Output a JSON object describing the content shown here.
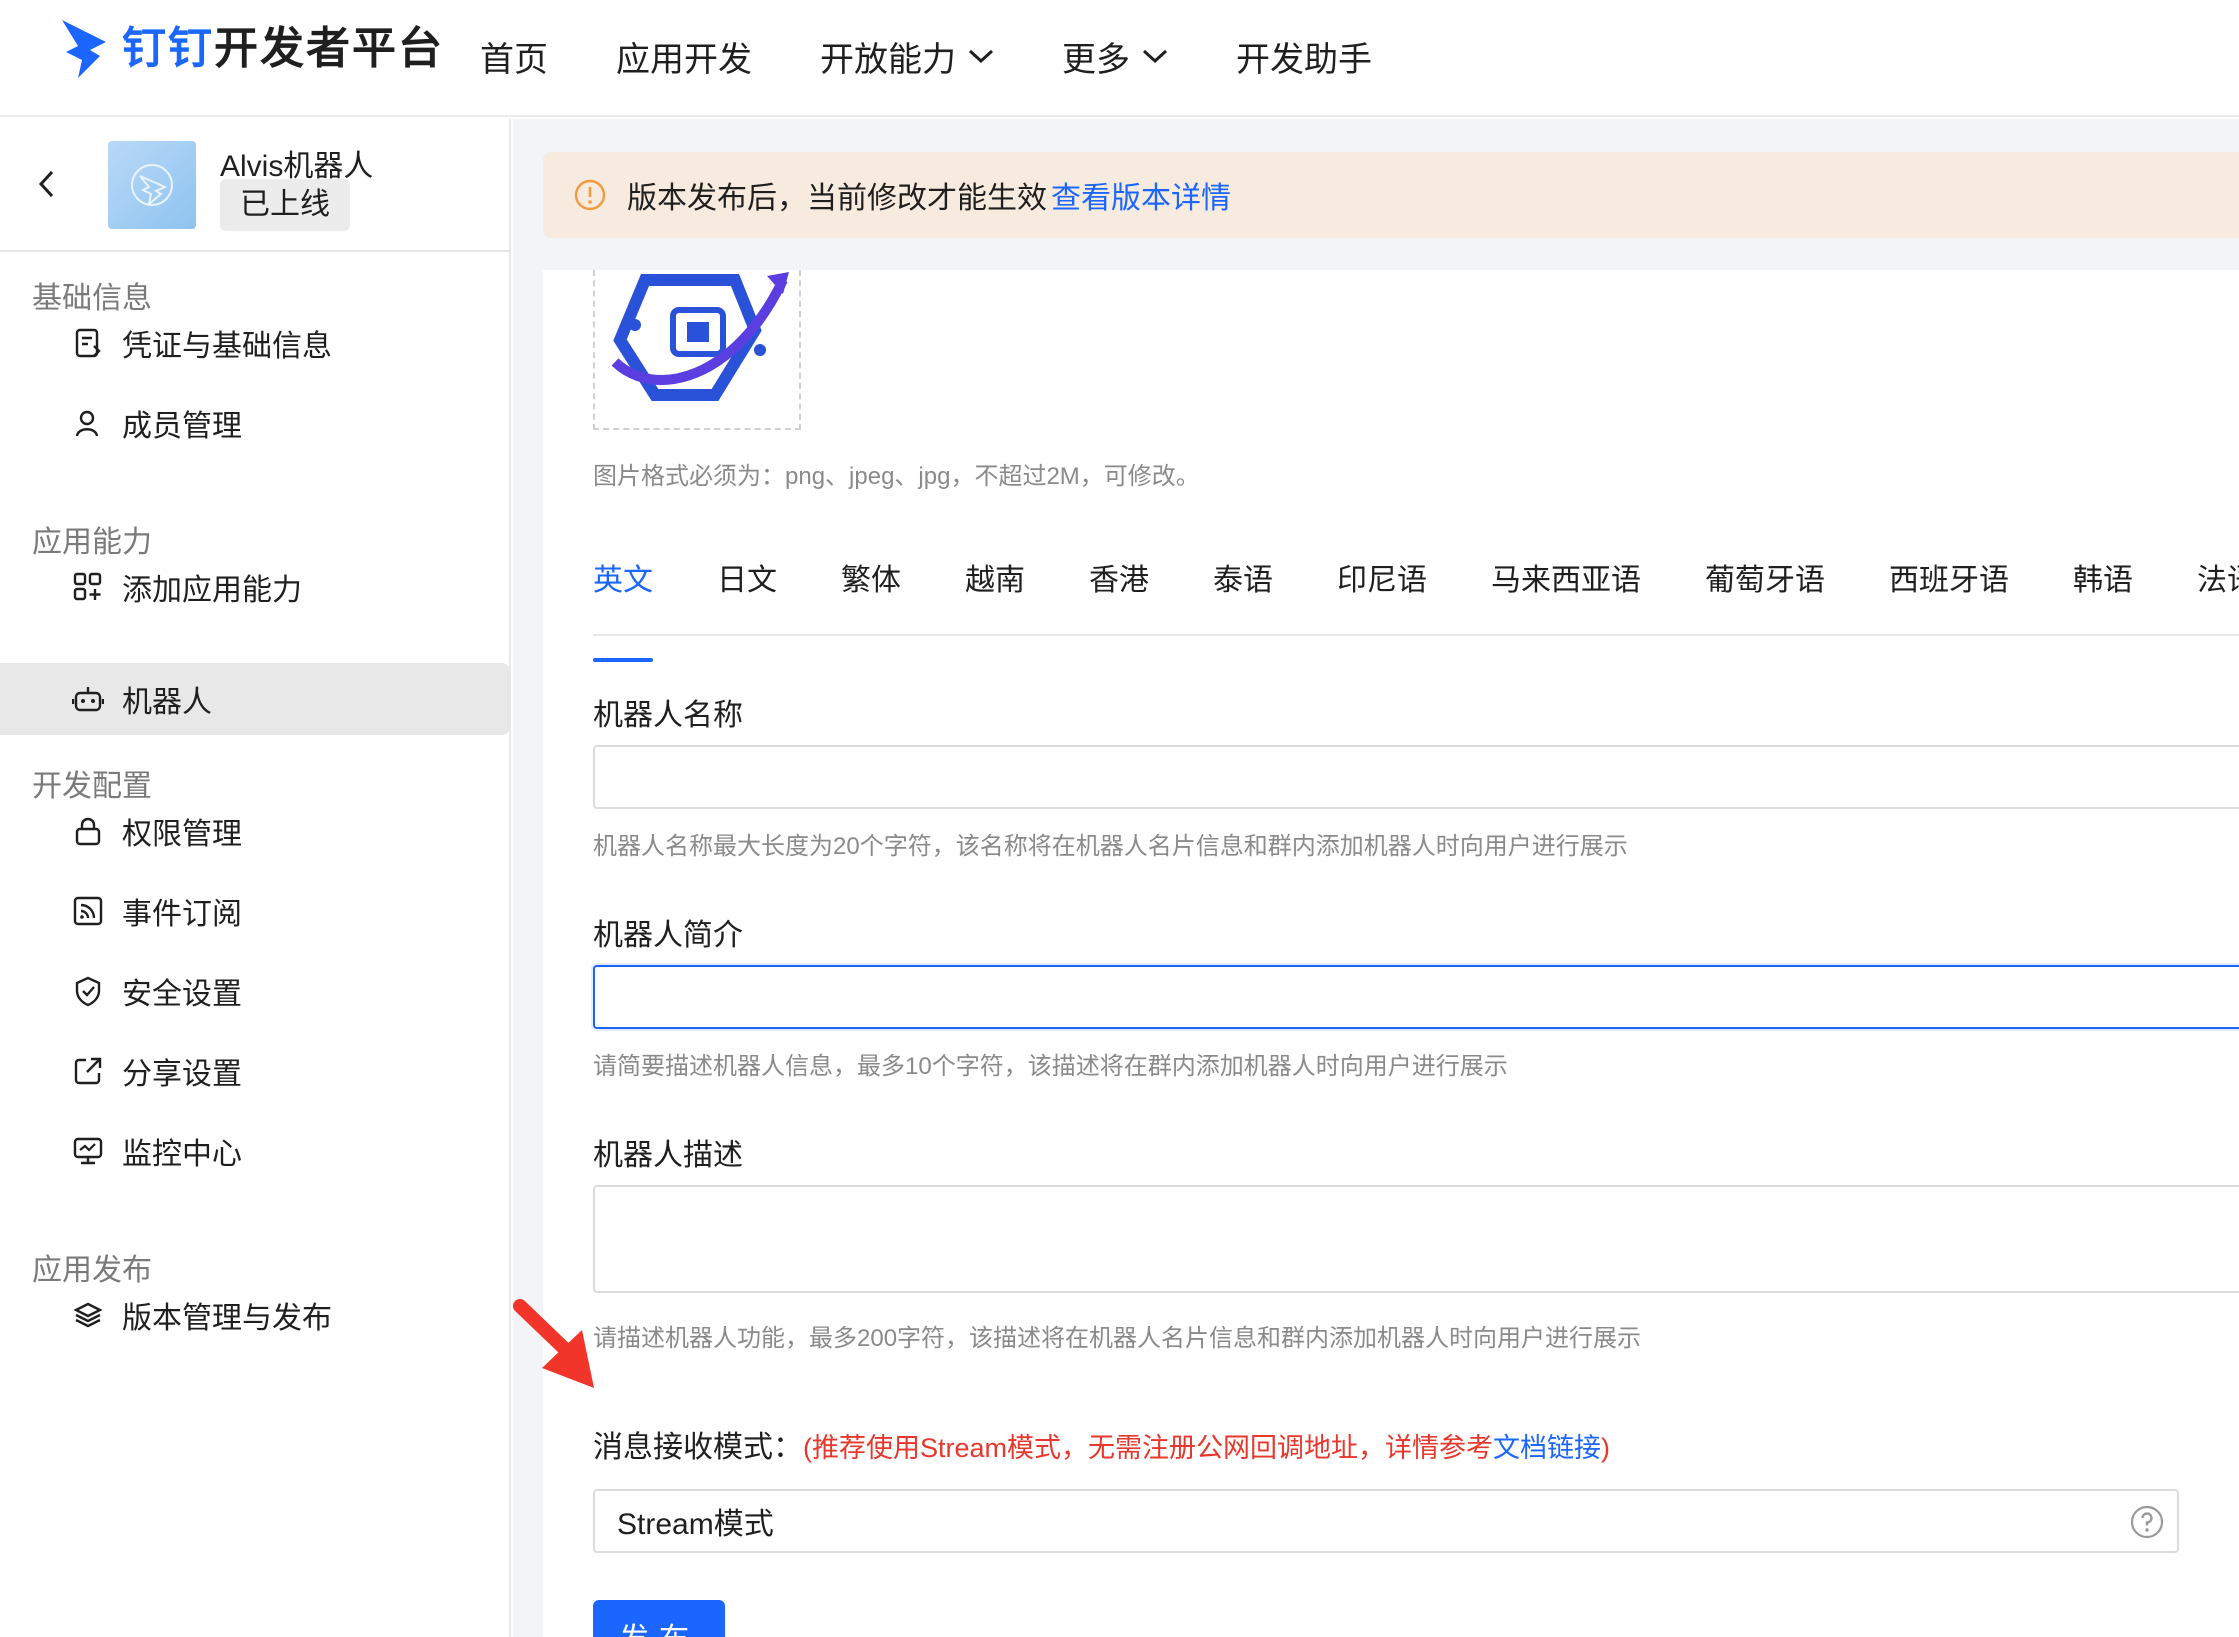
{
  "header": {
    "logo_brand": "钉钉",
    "logo_rest": "开发者平台",
    "nav": [
      {
        "label": "首页"
      },
      {
        "label": "应用开发"
      },
      {
        "label": "开放能力"
      },
      {
        "label": "更多"
      },
      {
        "label": "开发助手"
      }
    ]
  },
  "sidebar": {
    "app_name": "Alvis机器人",
    "app_status": "已上线",
    "groups": [
      {
        "title": "基础信息",
        "items": [
          {
            "label": "凭证与基础信息"
          },
          {
            "label": "成员管理"
          }
        ]
      },
      {
        "title": "应用能力",
        "items": [
          {
            "label": "添加应用能力"
          },
          {
            "label": "机器人"
          }
        ]
      },
      {
        "title": "开发配置",
        "items": [
          {
            "label": "权限管理"
          },
          {
            "label": "事件订阅"
          },
          {
            "label": "安全设置"
          },
          {
            "label": "分享设置"
          },
          {
            "label": "监控中心"
          }
        ]
      },
      {
        "title": "应用发布",
        "items": [
          {
            "label": "版本管理与发布"
          }
        ]
      }
    ]
  },
  "main": {
    "notice_text": "版本发布后，当前修改才能生效",
    "notice_link": "查看版本详情",
    "icon_hint": "图片格式必须为：png、jpeg、jpg，不超过2M，可修改。",
    "tabs": [
      "英文",
      "日文",
      "繁体",
      "越南",
      "香港",
      "泰语",
      "印尼语",
      "马来西亚语",
      "葡萄牙语",
      "西班牙语",
      "韩语",
      "法语"
    ],
    "fields": {
      "name": {
        "label": "机器人名称",
        "value": "",
        "hint": "机器人名称最大长度为20个字符，该名称将在机器人名片信息和群内添加机器人时向用户进行展示"
      },
      "intro": {
        "label": "机器人简介",
        "value": "",
        "hint": "请简要描述机器人信息，最多10个字符，该描述将在群内添加机器人时向用户进行展示"
      },
      "desc": {
        "label": "机器人描述",
        "value": "",
        "hint": "请描述机器人功能，最多200字符，该描述将在机器人名片信息和群内添加机器人时向用户进行展示"
      }
    },
    "mode": {
      "label": "消息接收模式：",
      "recommend_prefix": "(推荐使用Stream模式，无需注册公网回调地址，详情参考",
      "doc_link": "文档链接",
      "recommend_suffix": ")",
      "selected": "Stream模式"
    },
    "publish_label": "发布"
  }
}
